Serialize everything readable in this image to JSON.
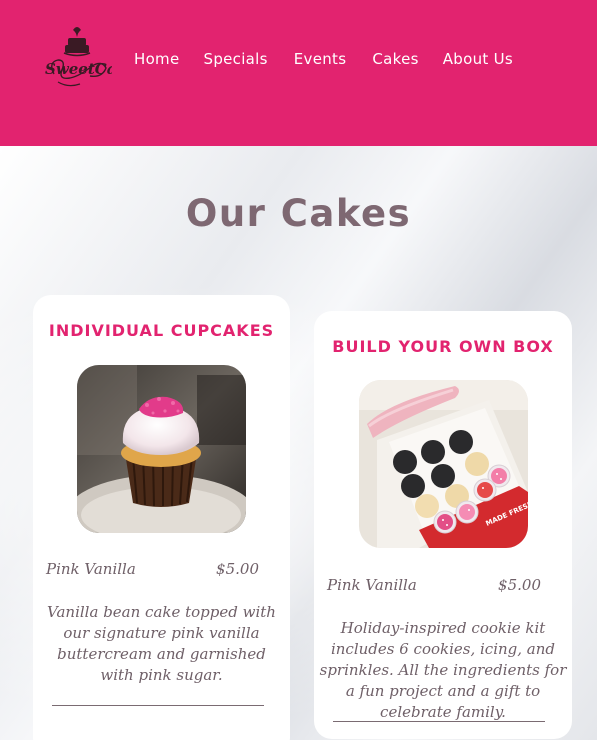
{
  "header": {
    "logo_text": "SweetCake",
    "nav": [
      "Home",
      "Specials",
      "Events",
      "Cakes",
      "About Us"
    ],
    "bg_color": "#e2236f"
  },
  "main": {
    "title": "Our Cakes",
    "cards": [
      {
        "heading": "INDIVIDUAL CUPCAKES",
        "photo_icon": "cupcake-photo",
        "item_name": "Pink Vanilla",
        "price": "$5.00",
        "description": "Vanilla bean cake topped with our signature pink vanilla buttercream and garnished with pink sugar."
      },
      {
        "heading": "BUILD YOUR OWN BOX",
        "photo_icon": "cookie-kit-photo",
        "item_name": "Pink Vanilla",
        "price": "$5.00",
        "description": "Holiday-inspired cookie kit includes 6 cookies, icing, and sprinkles. All the ingredients for a fun project and a gift to celebrate family."
      }
    ]
  }
}
